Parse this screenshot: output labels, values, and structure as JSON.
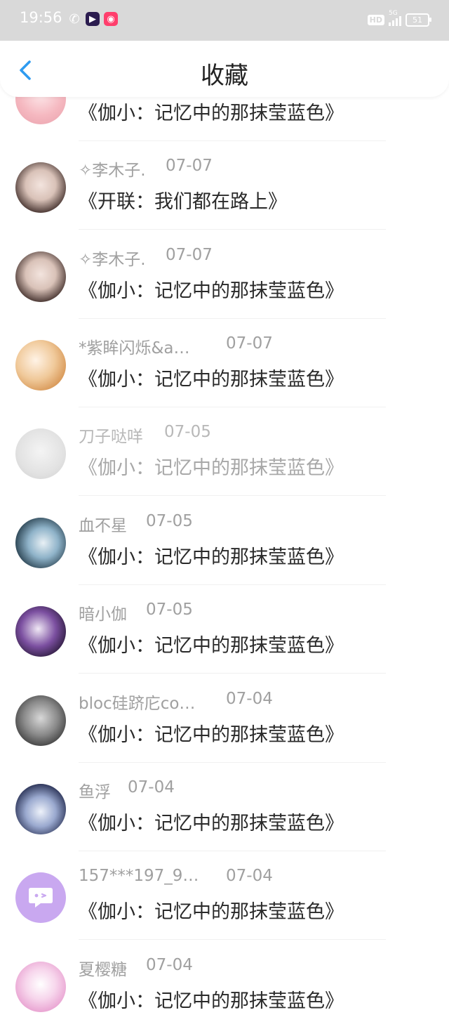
{
  "status_bar": {
    "time": "19:56",
    "hd": "HD",
    "network": "5G",
    "battery": "51",
    "apps": [
      "wechat-icon",
      "video-app-icon",
      "camera-app-icon"
    ]
  },
  "header": {
    "title": "收藏",
    "back_icon": "chevron-left-icon",
    "accent": "#2e9bf0"
  },
  "items": [
    {
      "name": "",
      "date": "",
      "work": "《伽小：记忆中的那抹莹蓝色》"
    },
    {
      "name": "✧李木子.",
      "date": "07-07",
      "work": "《开联：我们都在路上》"
    },
    {
      "name": "✧李木子.",
      "date": "07-07",
      "work": "《伽小：记忆中的那抹莹蓝色》"
    },
    {
      "name": "*紫眸闪烁&a…",
      "date": "07-07",
      "work": "《伽小：记忆中的那抹莹蓝色》"
    },
    {
      "name": "刀子哒咩",
      "date": "07-05",
      "work": "《伽小：记忆中的那抹莹蓝色》"
    },
    {
      "name": "血不星",
      "date": "07-05",
      "work": "《伽小：记忆中的那抹莹蓝色》"
    },
    {
      "name": "暗小伽",
      "date": "07-05",
      "work": "《伽小：记忆中的那抹莹蓝色》"
    },
    {
      "name": "bloc硅跻庀co…",
      "date": "07-04",
      "work": "《伽小：记忆中的那抹莹蓝色》"
    },
    {
      "name": "鱼浮",
      "date": "07-04",
      "work": "《伽小：记忆中的那抹莹蓝色》"
    },
    {
      "name": "157***197_9…",
      "date": "07-04",
      "work": "《伽小：记忆中的那抹莹蓝色》"
    },
    {
      "name": "夏樱糖",
      "date": "07-04",
      "work": "《伽小：记忆中的那抹莹蓝色》"
    }
  ]
}
